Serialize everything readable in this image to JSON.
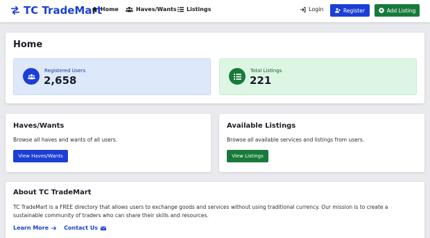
{
  "brand": {
    "name": "TC TradeMart",
    "icon": "exchange-arrows-icon"
  },
  "nav": {
    "links": [
      {
        "label": "Home",
        "icon": "home-icon"
      },
      {
        "label": "Haves/Wants",
        "icon": "users-icon"
      },
      {
        "label": "Listings",
        "icon": "list-icon"
      }
    ],
    "login_label": "Login",
    "register_label": "Register",
    "add_listing_label": "Add Listing"
  },
  "home": {
    "title": "Home",
    "stats": {
      "users": {
        "label": "Registered Users",
        "value": "2,658",
        "icon": "users-icon"
      },
      "listings": {
        "label": "Total Listings",
        "value": "221",
        "icon": "list-icon"
      }
    }
  },
  "haves_wants": {
    "title": "Haves/Wants",
    "description": "Browse all haves and wants of all users.",
    "button": "View Haves/Wants"
  },
  "available_listings": {
    "title": "Available Listings",
    "description": "Browse all available services and listings from users.",
    "button": "View Listings"
  },
  "about": {
    "title": "About TC TradeMart",
    "text": "TC TradeMart is a FREE directory that allows users to exchange goods and services without using traditional currency. Our mission is to create a sustainable community of traders who can share their skills and resources.",
    "learn_more": "Learn More",
    "contact_us": "Contact Us"
  },
  "colors": {
    "primary": "#1b3fd6",
    "success": "#177a3a",
    "background": "#e9eaee"
  }
}
